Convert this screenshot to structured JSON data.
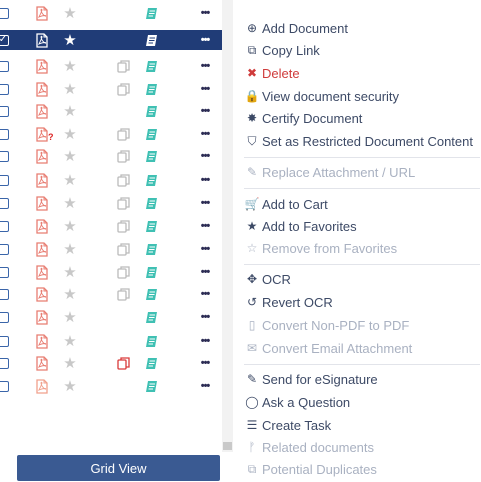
{
  "grid": {
    "rows": [
      {
        "selected": false,
        "pdf_color": "#e87d72",
        "duplicate": false,
        "duplicate_color": "#bbbbbb",
        "attachment": true,
        "pdf_question": false
      },
      {
        "selected": true,
        "pdf_color": "#ffffff",
        "duplicate": false,
        "duplicate_color": "#bbbbbb",
        "attachment": true,
        "pdf_question": false
      },
      {
        "selected": false,
        "pdf_color": "#e87d72",
        "duplicate": true,
        "duplicate_color": "#bbbbbb",
        "attachment": true,
        "pdf_question": false
      },
      {
        "selected": false,
        "pdf_color": "#e87d72",
        "duplicate": true,
        "duplicate_color": "#bbbbbb",
        "attachment": true,
        "pdf_question": false
      },
      {
        "selected": false,
        "pdf_color": "#e87d72",
        "duplicate": false,
        "duplicate_color": "#bbbbbb",
        "attachment": true,
        "pdf_question": false
      },
      {
        "selected": false,
        "pdf_color": "#e87d72",
        "duplicate": true,
        "duplicate_color": "#bbbbbb",
        "attachment": true,
        "pdf_question": true
      },
      {
        "selected": false,
        "pdf_color": "#e87d72",
        "duplicate": true,
        "duplicate_color": "#bbbbbb",
        "attachment": true,
        "pdf_question": false
      },
      {
        "selected": false,
        "pdf_color": "#e87d72",
        "duplicate": true,
        "duplicate_color": "#bbbbbb",
        "attachment": true,
        "pdf_question": false
      },
      {
        "selected": false,
        "pdf_color": "#e87d72",
        "duplicate": true,
        "duplicate_color": "#bbbbbb",
        "attachment": true,
        "pdf_question": false
      },
      {
        "selected": false,
        "pdf_color": "#e87d72",
        "duplicate": true,
        "duplicate_color": "#bbbbbb",
        "attachment": true,
        "pdf_question": false
      },
      {
        "selected": false,
        "pdf_color": "#e87d72",
        "duplicate": true,
        "duplicate_color": "#bbbbbb",
        "attachment": true,
        "pdf_question": false
      },
      {
        "selected": false,
        "pdf_color": "#e87d72",
        "duplicate": true,
        "duplicate_color": "#bbbbbb",
        "attachment": true,
        "pdf_question": false
      },
      {
        "selected": false,
        "pdf_color": "#e87d72",
        "duplicate": true,
        "duplicate_color": "#bbbbbb",
        "attachment": true,
        "pdf_question": false
      },
      {
        "selected": false,
        "pdf_color": "#e87d72",
        "duplicate": false,
        "duplicate_color": "#bbbbbb",
        "attachment": true,
        "pdf_question": false
      },
      {
        "selected": false,
        "pdf_color": "#e87d72",
        "duplicate": false,
        "duplicate_color": "#bbbbbb",
        "attachment": true,
        "pdf_question": false
      },
      {
        "selected": false,
        "pdf_color": "#e87d72",
        "duplicate": true,
        "duplicate_color": "#d93a3a",
        "attachment": true,
        "pdf_question": false
      },
      {
        "selected": false,
        "pdf_color": "#f0a08c",
        "duplicate": false,
        "duplicate_color": "#bbbbbb",
        "attachment": true,
        "pdf_question": false
      }
    ],
    "more_label": "•••",
    "question_mark": "?",
    "grid_view_label": "Grid View"
  },
  "menu": {
    "items": [
      {
        "label": "Add Document",
        "icon": "plus-circle-icon",
        "glyph": "⊕",
        "state": "enabled"
      },
      {
        "label": "Copy Link",
        "icon": "copy-icon",
        "glyph": "⧉",
        "state": "enabled"
      },
      {
        "label": "Delete",
        "icon": "close-icon",
        "glyph": "✖",
        "state": "danger"
      },
      {
        "label": "View document security",
        "icon": "lock-icon",
        "glyph": "🔒",
        "state": "enabled"
      },
      {
        "label": "Certify Document",
        "icon": "certify-seal-icon",
        "glyph": "✸",
        "state": "enabled"
      },
      {
        "label": "Set as Restricted Document Content",
        "icon": "shield-icon",
        "glyph": "⛉",
        "state": "enabled"
      },
      {
        "label": "Replace Attachment / URL",
        "icon": "paperclip-icon",
        "glyph": "✎",
        "state": "disabled"
      },
      {
        "label": "Add to Cart",
        "icon": "cart-icon",
        "glyph": "🛒",
        "state": "enabled"
      },
      {
        "label": "Add to Favorites",
        "icon": "star-icon",
        "glyph": "★",
        "state": "enabled"
      },
      {
        "label": "Remove from Favorites",
        "icon": "star-outline-icon",
        "glyph": "☆",
        "state": "disabled"
      },
      {
        "label": "OCR",
        "icon": "ocr-icon",
        "glyph": "✥",
        "state": "enabled"
      },
      {
        "label": "Revert OCR",
        "icon": "undo-icon",
        "glyph": "↺",
        "state": "enabled"
      },
      {
        "label": "Convert Non-PDF to PDF",
        "icon": "pdf-file-icon",
        "glyph": "▯",
        "state": "disabled"
      },
      {
        "label": "Convert Email Attachment",
        "icon": "envelope-icon",
        "glyph": "✉",
        "state": "disabled"
      },
      {
        "label": "Send for eSignature",
        "icon": "edit-icon",
        "glyph": "✎",
        "state": "enabled"
      },
      {
        "label": "Ask a Question",
        "icon": "comment-icon",
        "glyph": "◯",
        "state": "enabled"
      },
      {
        "label": "Create Task",
        "icon": "task-list-icon",
        "glyph": "☰",
        "state": "enabled"
      },
      {
        "label": "Related documents",
        "icon": "related-icon",
        "glyph": "ᚠ",
        "state": "disabled"
      },
      {
        "label": "Potential Duplicates",
        "icon": "duplicates-icon",
        "glyph": "⧉",
        "state": "disabled"
      }
    ]
  },
  "colors": {
    "selected_row": "#203c77",
    "menu_text": "#3d4a66",
    "menu_disabled": "#a9b1c1",
    "danger": "#cf3b3b",
    "attachment_teal": "#3fc0b3"
  }
}
